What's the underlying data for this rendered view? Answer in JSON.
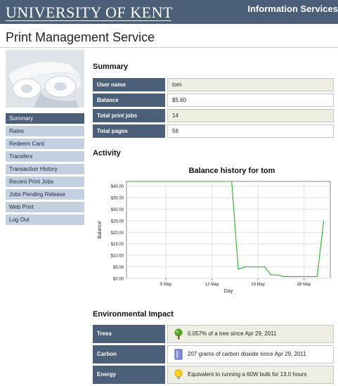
{
  "header": {
    "brand": "UNIVERSITY OF KENT",
    "service": "Information Services"
  },
  "page_title": "Print Management Service",
  "colors": {
    "header_bg": "#4b5f79",
    "nav_bg": "#c3d0e0",
    "nav_active_bg": "#4b5f79",
    "row_shade": "#efeee3",
    "chart_line": "#33aa33"
  },
  "nav": {
    "items": [
      {
        "label": "Summary",
        "active": true
      },
      {
        "label": "Rates"
      },
      {
        "label": "Redeem Card"
      },
      {
        "label": "Transfers"
      },
      {
        "label": "Transaction History"
      },
      {
        "label": "Recent Print Jobs"
      },
      {
        "label": "Jobs Pending Release"
      },
      {
        "label": "Web Print"
      },
      {
        "label": "Log Out"
      }
    ]
  },
  "summary": {
    "heading": "Summary",
    "rows": [
      {
        "label": "User name",
        "value": "tom"
      },
      {
        "label": "Balance",
        "value": "$5.60"
      },
      {
        "label": "Total print jobs",
        "value": "14"
      },
      {
        "label": "Total pages",
        "value": "56"
      }
    ]
  },
  "activity": {
    "heading": "Activity"
  },
  "chart_data": {
    "type": "line",
    "title": "Balance history for tom",
    "xlabel": "Day",
    "ylabel": "Balance",
    "ylim": [
      0,
      42
    ],
    "yticks": [
      "$0.00",
      "$5.00",
      "$10.00",
      "$15.00",
      "$20.00",
      "$25.00",
      "$30.00",
      "$35.00",
      "$40.00"
    ],
    "xticks": [
      "5 May",
      "12 May",
      "19 May",
      "26 May"
    ],
    "xlim": [
      "2011-04-29",
      "2011-05-30"
    ],
    "grid": true,
    "series": [
      {
        "x": [
          "2011-04-29",
          "2011-05-15",
          "2011-05-16",
          "2011-05-17",
          "2011-05-18",
          "2011-05-19",
          "2011-05-20",
          "2011-05-21",
          "2011-05-22",
          "2011-05-23",
          "2011-05-24",
          "2011-05-25",
          "2011-05-26",
          "2011-05-27",
          "2011-05-28",
          "2011-05-29"
        ],
        "values": [
          42,
          42,
          4,
          5,
          5,
          5,
          5,
          1.5,
          1.5,
          0.8,
          0.8,
          0.8,
          0.8,
          0.8,
          0.8,
          25
        ]
      }
    ]
  },
  "environment": {
    "heading": "Environmental Impact",
    "rows": [
      {
        "label": "Trees",
        "value": "0.057% of a tree since Apr 29, 2011",
        "icon": "tree-icon"
      },
      {
        "label": "Carbon",
        "value": "207 grams of carbon dioxide since Apr 29, 2011",
        "icon": "carbon-icon"
      },
      {
        "label": "Energy",
        "value": "Equivalent to running a 60W bulb for 13.0 hours",
        "icon": "bulb-icon"
      }
    ]
  }
}
